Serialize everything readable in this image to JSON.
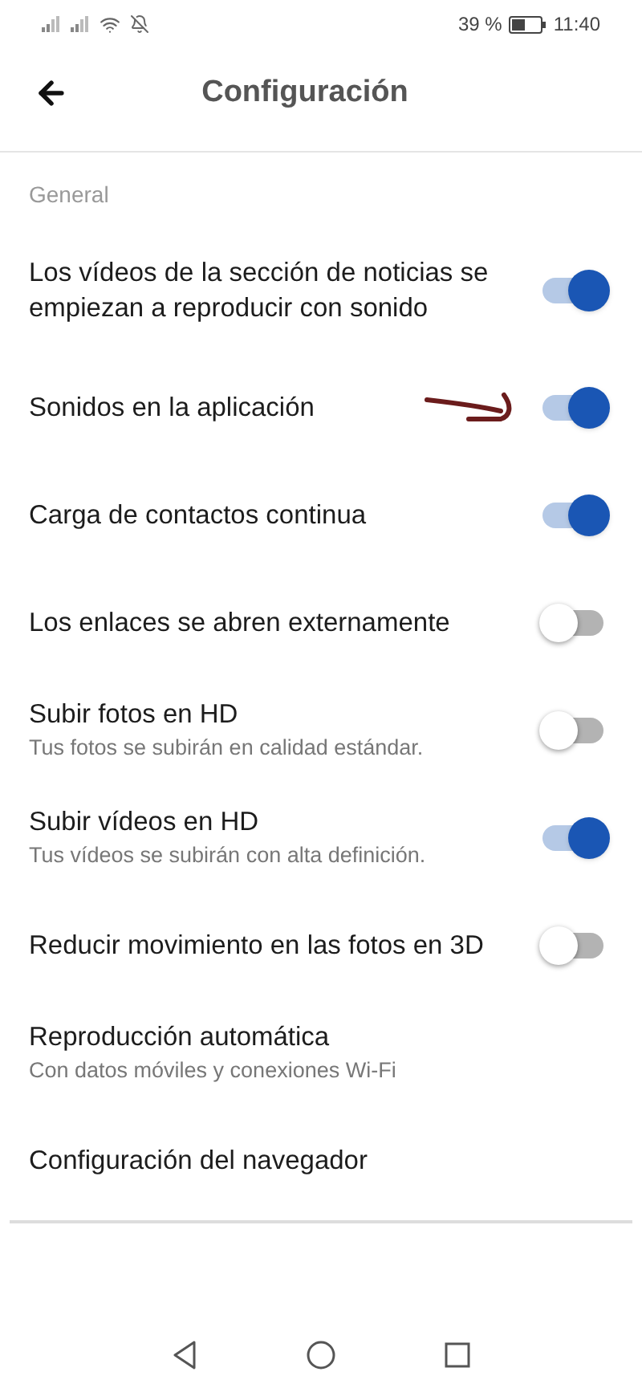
{
  "status_bar": {
    "battery_percent": "39 %",
    "time": "11:40"
  },
  "header": {
    "title": "Configuración"
  },
  "section": {
    "title": "General"
  },
  "settings": [
    {
      "title": "Los vídeos de la sección de noticias se empiezan a reproducir con sonido",
      "kind": "toggle",
      "on": true
    },
    {
      "title": "Sonidos en la aplicación",
      "kind": "toggle",
      "on": true,
      "annotated": true
    },
    {
      "title": "Carga de contactos continua",
      "kind": "toggle",
      "on": true
    },
    {
      "title": "Los enlaces se abren externamente",
      "kind": "toggle",
      "on": false
    },
    {
      "title": "Subir fotos en HD",
      "subtitle": "Tus fotos se subirán en calidad estándar.",
      "kind": "toggle",
      "on": false
    },
    {
      "title": "Subir vídeos en HD",
      "subtitle": "Tus vídeos se subirán con alta definición.",
      "kind": "toggle",
      "on": true
    },
    {
      "title": "Reducir movimiento en las fotos en 3D",
      "kind": "toggle",
      "on": false
    },
    {
      "title": "Reproducción automática",
      "subtitle": "Con datos móviles y conexiones Wi-Fi",
      "kind": "link"
    },
    {
      "title": "Configuración del navegador",
      "kind": "link"
    }
  ]
}
